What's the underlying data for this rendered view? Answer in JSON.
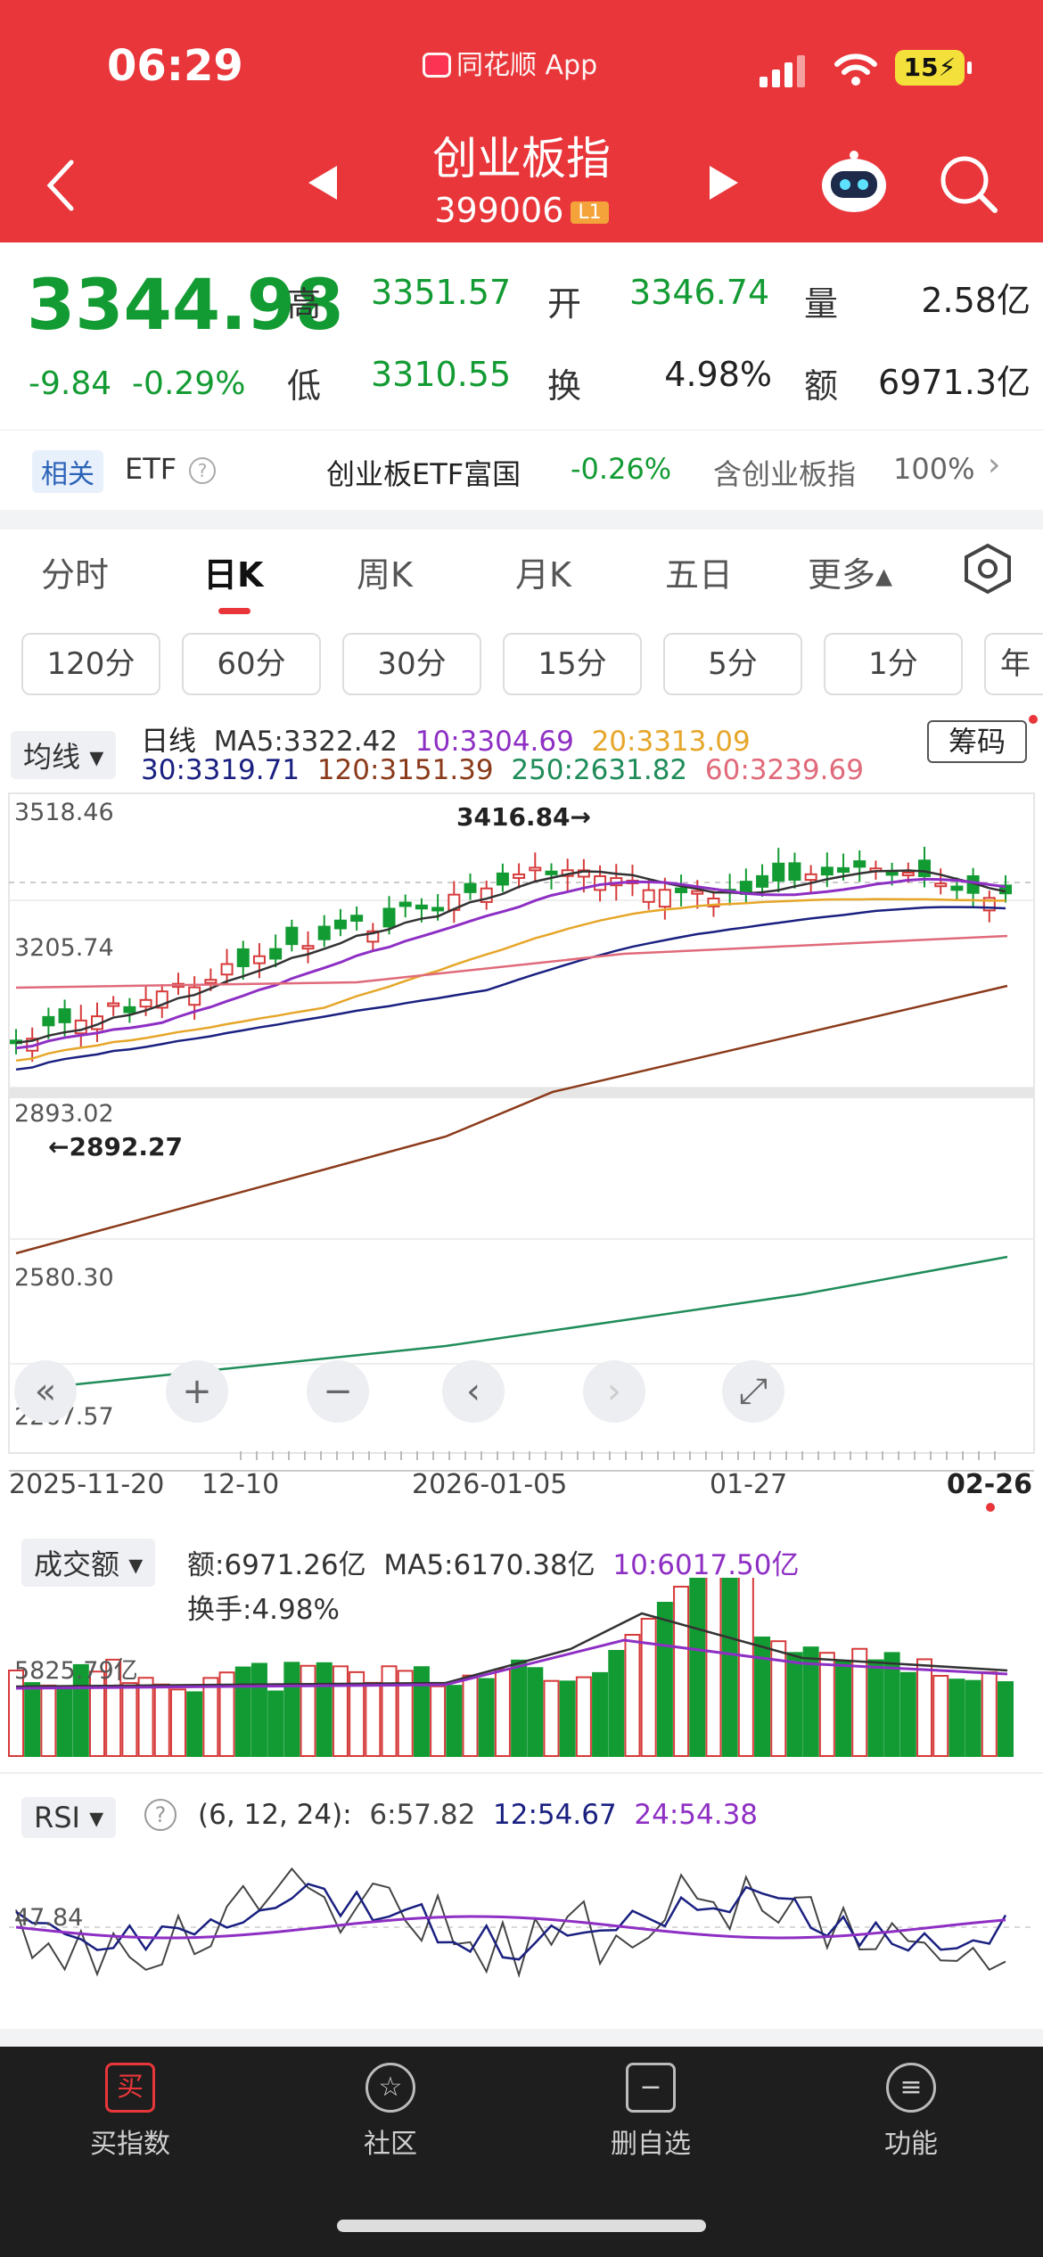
{
  "status": {
    "time": "06:29",
    "app": "同花顺 App",
    "battery": "15"
  },
  "header": {
    "title": "创业板指",
    "code": "399006",
    "level": "L1"
  },
  "quote": {
    "price": "3344.98",
    "change": "-9.84",
    "change_pct": "-0.29%",
    "high_label": "高",
    "high": "3351.57",
    "open_label": "开",
    "open": "3346.74",
    "vol_label": "量",
    "vol": "2.58亿",
    "low_label": "低",
    "low": "3310.55",
    "turn_label": "换",
    "turn": "4.98%",
    "amt_label": "额",
    "amt": "6971.3亿"
  },
  "etf": {
    "tag": "相关",
    "label": "ETF",
    "name": "创业板ETF富国",
    "pct": "-0.26%",
    "hold": "含创业板指",
    "weight": "100%"
  },
  "tabs": [
    "分时",
    "日K",
    "周K",
    "月K",
    "五日",
    "更多▴"
  ],
  "periods": [
    "120分",
    "60分",
    "30分",
    "15分",
    "5分",
    "1分",
    "年"
  ],
  "kline": {
    "chip": "均线",
    "period": "日线",
    "chips_btn": "筹码",
    "ma5": "MA5:3322.42",
    "ma10": "10:3304.69",
    "ma20": "20:3313.09",
    "ma30": "30:3319.71",
    "ma120": "120:3151.39",
    "ma250": "250:2631.82",
    "ma60": "60:3239.69",
    "y_top": "3518.46",
    "y_mid": "3205.74",
    "y_low": "2893.02",
    "y_2": "2580.30",
    "y_3": "2267.57",
    "high_mark": "3416.84→",
    "low_mark": "←2892.27",
    "dates": [
      "2025-11-20",
      "12-10",
      "2026-01-05",
      "01-27",
      "02-26"
    ]
  },
  "volume": {
    "chip": "成交额",
    "amt": "额:6971.26亿",
    "ma5": "MA5:6170.38亿",
    "ma10": "10:6017.50亿",
    "turn": "换手:4.98%",
    "y_label": "5825.79亿"
  },
  "rsi": {
    "chip": "RSI",
    "params": "(6, 12, 24):",
    "r6": "6:57.82",
    "r12": "12:54.67",
    "r24": "24:54.38",
    "y_label": "47.84"
  },
  "bottom_nav": [
    {
      "label": "买指数",
      "icon": "买"
    },
    {
      "label": "社区",
      "icon": "☆"
    },
    {
      "label": "删自选",
      "icon": "−"
    },
    {
      "label": "功能",
      "icon": "≡"
    }
  ],
  "colors": {
    "up": "#d63a3a",
    "down": "#139b33",
    "header": "#e8363a",
    "ma5": "#333333",
    "ma10": "#8e2fc4",
    "ma20": "#e6a62a",
    "ma30": "#1a2080",
    "ma60": "#e06a7a",
    "ma120": "#8b3a1a",
    "ma250": "#1f8c5a"
  }
}
